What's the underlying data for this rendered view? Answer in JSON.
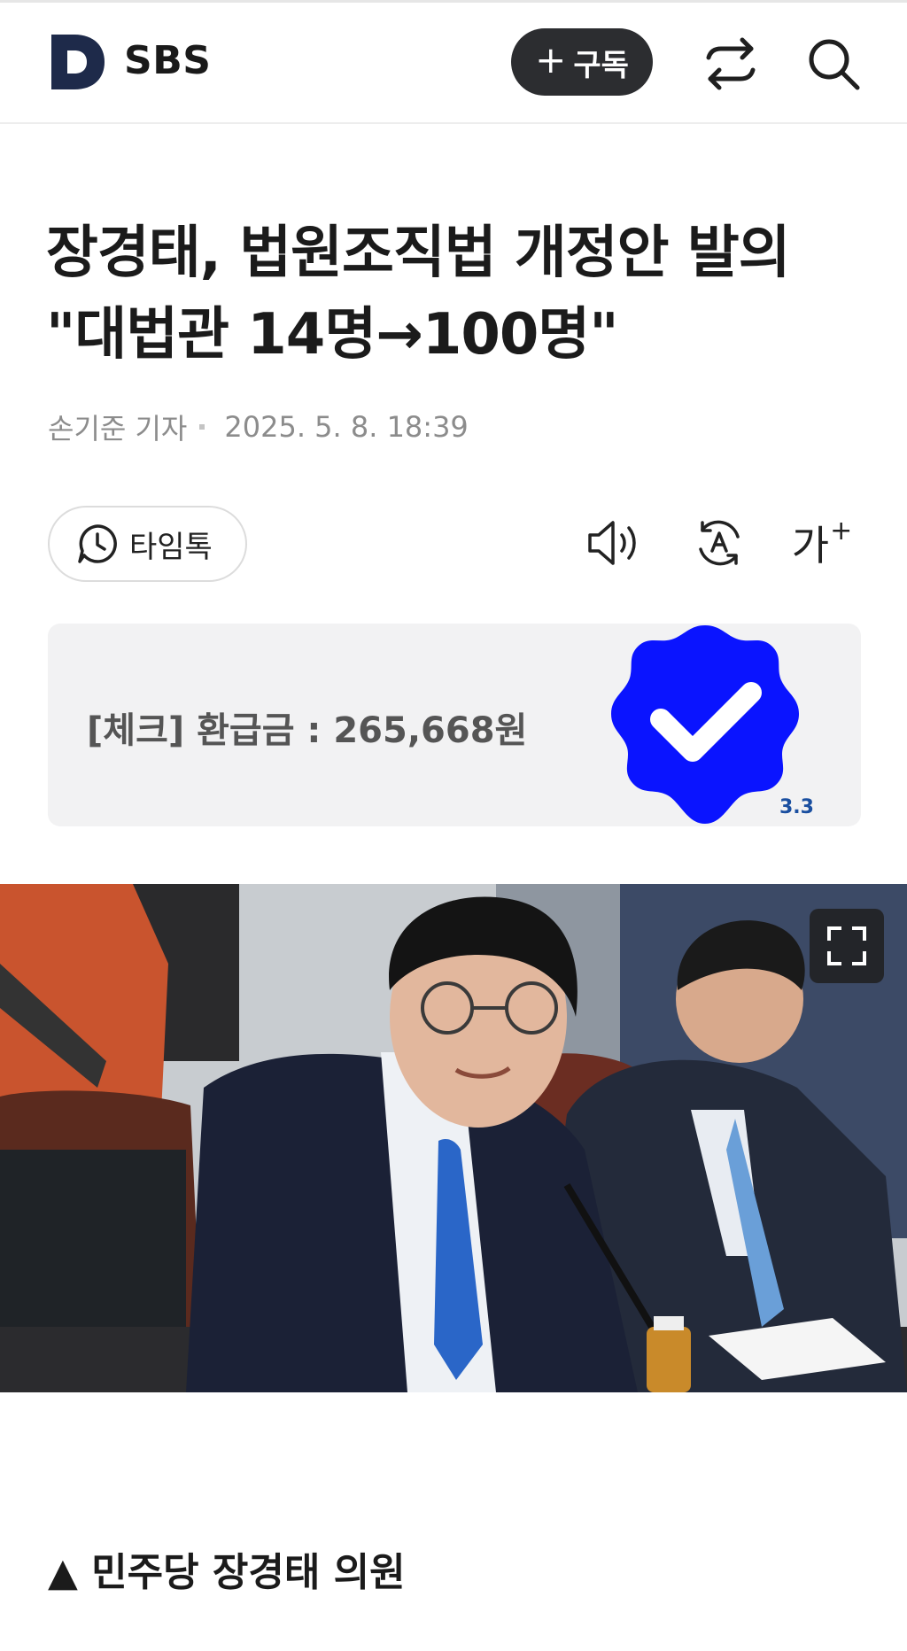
{
  "header": {
    "brand": "SBS",
    "logo_letter": "D",
    "subscribe_plus": "+",
    "subscribe_label": "구독",
    "share_icon": "share-icon",
    "search_icon": "search-icon"
  },
  "article": {
    "headline_line1": "장경태, 법원조직법 개정안 발의",
    "headline_line2": "\"대법관 14명→100명\"",
    "reporter": "손기준 기자",
    "datetime": "2025. 5. 8. 18:39"
  },
  "toolbar": {
    "timetalk_label": "타임톡",
    "timetalk_icon": "clock-chat-icon",
    "tts_icon": "speaker-icon",
    "translate_icon": "translate-icon",
    "font_label": "가",
    "font_plus": "+"
  },
  "ad": {
    "text": "[체크] 환급금 : 265,668원",
    "badge_label": "3.3",
    "badge_color": "#0a14ff"
  },
  "photo": {
    "expand_icon": "expand-icon"
  },
  "caption": {
    "text": "▲ 민주당 장경태 의원"
  },
  "colors": {
    "subscribe_bg": "#2c2d30",
    "logo": "#1e2a4a",
    "text": "#1b1b1b",
    "meta": "#8c8c8c"
  }
}
